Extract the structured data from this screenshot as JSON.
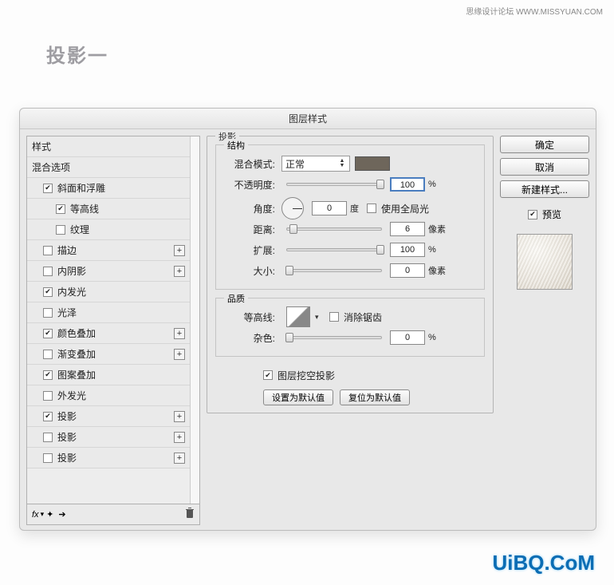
{
  "watermark": "思缘设计论坛   WWW.MISSYUAN.COM",
  "page_title": "投影一",
  "dialog_title": "图层样式",
  "styles": {
    "header1": "样式",
    "header2": "混合选项",
    "items": [
      {
        "label": "斜面和浮雕",
        "checked": true,
        "indent": 1,
        "add": false
      },
      {
        "label": "等高线",
        "checked": true,
        "indent": 2,
        "add": false
      },
      {
        "label": "纹理",
        "checked": false,
        "indent": 2,
        "add": false
      },
      {
        "label": "描边",
        "checked": false,
        "indent": 1,
        "add": true
      },
      {
        "label": "内阴影",
        "checked": false,
        "indent": 1,
        "add": true
      },
      {
        "label": "内发光",
        "checked": true,
        "indent": 1,
        "add": false
      },
      {
        "label": "光泽",
        "checked": false,
        "indent": 1,
        "add": false
      },
      {
        "label": "颜色叠加",
        "checked": true,
        "indent": 1,
        "add": true
      },
      {
        "label": "渐变叠加",
        "checked": false,
        "indent": 1,
        "add": true
      },
      {
        "label": "图案叠加",
        "checked": true,
        "indent": 1,
        "add": false
      },
      {
        "label": "外发光",
        "checked": false,
        "indent": 1,
        "add": false
      },
      {
        "label": "投影",
        "checked": true,
        "indent": 1,
        "add": true
      },
      {
        "label": "投影",
        "checked": false,
        "indent": 1,
        "add": true
      },
      {
        "label": "投影",
        "checked": false,
        "indent": 1,
        "add": true
      }
    ],
    "footer_fx": "fx"
  },
  "shadow": {
    "group_label": "投影",
    "structure_label": "结构",
    "blend_mode_label": "混合模式:",
    "blend_mode_value": "正常",
    "opacity_label": "不透明度:",
    "opacity_value": "100",
    "opacity_unit": "%",
    "angle_label": "角度:",
    "angle_value": "0",
    "angle_unit": "度",
    "global_light_label": "使用全局光",
    "distance_label": "距离:",
    "distance_value": "6",
    "distance_unit": "像素",
    "spread_label": "扩展:",
    "spread_value": "100",
    "spread_unit": "%",
    "size_label": "大小:",
    "size_value": "0",
    "size_unit": "像素",
    "quality_label": "品质",
    "contour_label": "等高线:",
    "antialias_label": "消除锯齿",
    "noise_label": "杂色:",
    "noise_value": "0",
    "noise_unit": "%",
    "knockout_label": "图层挖空投影",
    "btn_default": "设置为默认值",
    "btn_reset": "复位为默认值"
  },
  "buttons": {
    "ok": "确定",
    "cancel": "取消",
    "new_style": "新建样式...",
    "preview": "预览"
  },
  "logo": "UiBQ.CoM"
}
